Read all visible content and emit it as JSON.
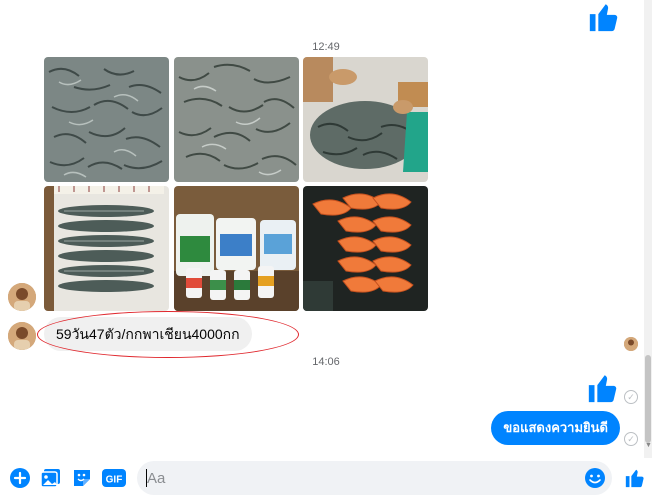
{
  "messages": {
    "timestamp_1": "12:49",
    "incoming_text": "59วัน47ตัว/กกพาเชียน4000กก",
    "timestamp_2": "14:06",
    "outgoing_text": "ขอแสดงความยินดี"
  },
  "photos": [
    {
      "icon": "shrimp-pile-photo"
    },
    {
      "icon": "shrimp-pile-photo"
    },
    {
      "icon": "shrimp-sorting-photo"
    },
    {
      "icon": "shrimp-measure-photo"
    },
    {
      "icon": "feed-products-photo"
    },
    {
      "icon": "cooked-shrimp-photo"
    }
  ],
  "composer": {
    "placeholder": "Aa",
    "gif_label": "GIF"
  },
  "colors": {
    "accent": "#0084ff",
    "incoming_bubble": "#f0f0f0",
    "annotation": "#e0282e"
  }
}
